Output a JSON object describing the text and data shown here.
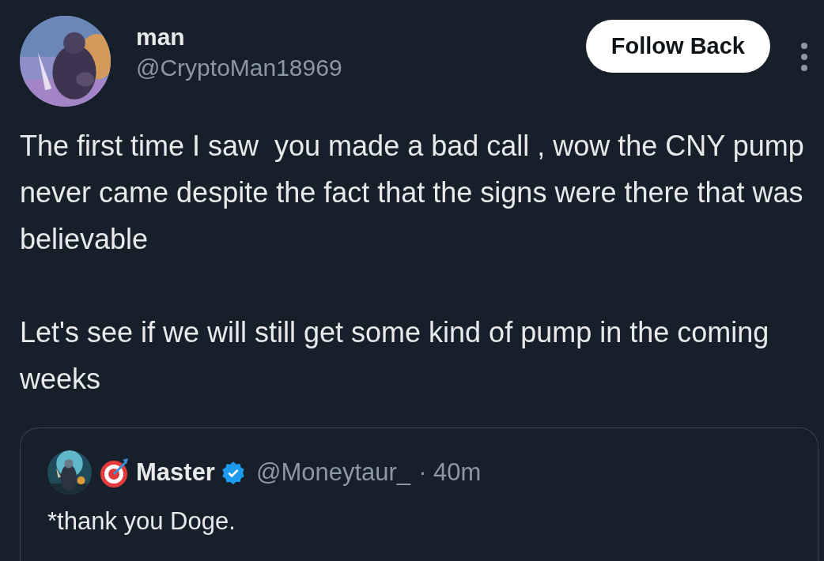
{
  "author": {
    "name": "man",
    "handle": "@CryptoMan18969"
  },
  "follow_button": {
    "label": "Follow Back"
  },
  "body": [
    "The first time I saw  you made a bad call , wow the CNY pump never came despite the fact that the signs were there that was believable",
    "Let's see if we will still get some kind of pump in the coming weeks"
  ],
  "quoted": {
    "name": "Master",
    "verified": true,
    "handle": "@Moneytaur_",
    "time": "· 40m",
    "text": "*thank you Doge."
  }
}
